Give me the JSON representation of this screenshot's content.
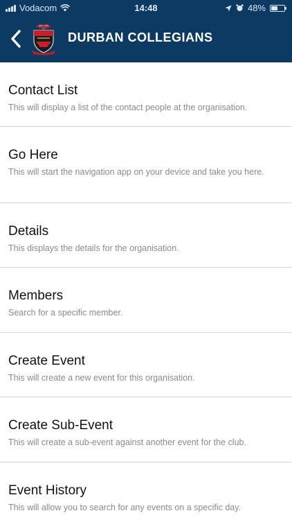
{
  "status_bar": {
    "carrier": "Vodacom",
    "time": "14:48",
    "battery_percent": "48%",
    "battery_level": 0.48
  },
  "header": {
    "title": "DURBAN COLLEGIANS",
    "background_color": "#0c3a62",
    "icons": [
      "back-chevron-icon",
      "club-crest-logo"
    ]
  },
  "menu": [
    {
      "label": "Contact List",
      "description": "This will display a list of the contact people at the organisation."
    },
    {
      "label": "Go Here",
      "description": "This will start the navigation app on your device and take you here."
    },
    {
      "label": "Details",
      "description": "This displays the details for the organisation."
    },
    {
      "label": "Members",
      "description": "Search for a specific member."
    },
    {
      "label": "Create Event",
      "description": "This will create a new event for this organisation."
    },
    {
      "label": "Create Sub-Event",
      "description": "This will create a sub-event against another event for the club."
    },
    {
      "label": "Event History",
      "description": "This will allow you to search for any events on a specific day."
    }
  ]
}
